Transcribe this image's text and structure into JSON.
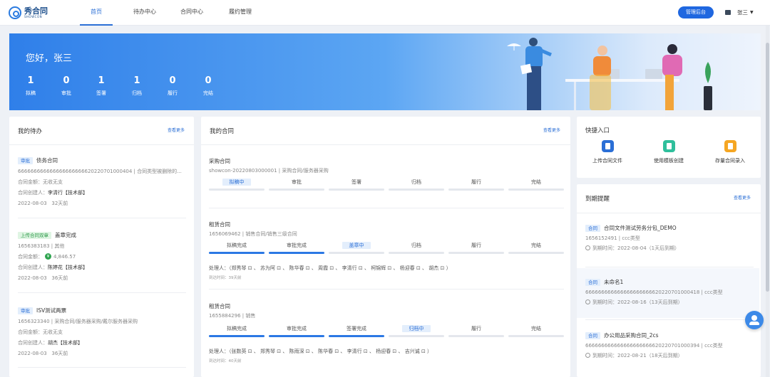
{
  "brand": {
    "name": "秀合同",
    "sub": "SHOWCON"
  },
  "nav": {
    "tabs": [
      {
        "label": "首页",
        "active": true
      },
      {
        "label": "待办中心"
      },
      {
        "label": "合同中心"
      },
      {
        "label": "履约管理"
      }
    ],
    "admin_label": "管理后台",
    "user_name": "张三"
  },
  "banner": {
    "greeting": "您好，张三",
    "stats": [
      {
        "num": "1",
        "label": "拟稿"
      },
      {
        "num": "0",
        "label": "审批"
      },
      {
        "num": "1",
        "label": "签署"
      },
      {
        "num": "1",
        "label": "归档"
      },
      {
        "num": "0",
        "label": "履行"
      },
      {
        "num": "0",
        "label": "完结"
      }
    ]
  },
  "todo": {
    "title": "我的待办",
    "more": "查看更多",
    "items": [
      {
        "tag": "审批",
        "tag_color": "blue",
        "title": "债务合同",
        "line1": "666666666666666666666620220701000404 | 合同类型被删除的...",
        "amount_label": "合同金额：",
        "amount": "无收无支",
        "creator_label": "合同创建人：",
        "creator": "李清行【技术部】",
        "date": "2022-08-03",
        "ago": "32天前"
      },
      {
        "tag": "上传合同双章",
        "tag_color": "green",
        "title": "盖章完成",
        "line1": "1656383183 | 其他",
        "amount_label": "合同金额：",
        "amount": "4,846.57",
        "creator_label": "合同创建人：",
        "creator": "陈婷花【技术部】",
        "date": "2022-08-03",
        "ago": "36天前"
      },
      {
        "tag": "审批",
        "tag_color": "blue",
        "title": "ISV测试两票",
        "line1": "1656323340 | 采购合同/服务器采购/戴尔服务器采购",
        "amount_label": "合同金额：",
        "amount": "无收无支",
        "creator_label": "合同创建人：",
        "creator": "胡杰【技术部】",
        "date": "2022-08-03",
        "ago": "36天前"
      }
    ]
  },
  "contracts": {
    "title": "我的合同",
    "more": "查看更多",
    "items": [
      {
        "title": "采购合同",
        "sub": "showcon-20220803000001 | 采购合同/服务器采购",
        "steps": [
          "拟稿中",
          "审批",
          "签署",
          "归档",
          "履行",
          "完结"
        ]
      },
      {
        "title": "租赁合同",
        "sub": "1656069462 | 销售合同/销售三级合同",
        "steps": [
          "拟稿完成",
          "审批完成",
          "盖章中",
          "归档",
          "履行",
          "完结"
        ],
        "handlers": "处理人：（郑秀琴 ⊡ 、 苏为阿 ⊡ 、 陈华春 ⊡ 、 周霞 ⊡ 、 李清行 ⊡ 、 柯锦辉 ⊡ 、 杨迎春 ⊡ 、 胡杰 ⊡ ）",
        "arrive": "到达时间：39天前"
      },
      {
        "title": "租赁合同",
        "sub": "1655884296 | 销售",
        "steps": [
          "拟稿完成",
          "审批完成",
          "签署完成",
          "归档中",
          "履行",
          "完结"
        ],
        "handlers": "处理人：（张数英 ⊡ 、 郑秀琴 ⊡ 、 陈雨深 ⊡ 、 陈华春 ⊡ 、 李清行 ⊡ 、 杨迎春 ⊡ 、 吉兴诚 ⊡ ）",
        "arrive": "到达时间：40天前"
      }
    ]
  },
  "quick": {
    "title": "快捷入口",
    "items": [
      {
        "label": "上传合同文件",
        "icon": "upload-file-icon",
        "color": "#2b6fd6"
      },
      {
        "label": "使用模板创建",
        "icon": "template-icon",
        "color": "#2fbf9c"
      },
      {
        "label": "存量合同录入",
        "icon": "archive-icon",
        "color": "#f5a623"
      }
    ]
  },
  "remind": {
    "title": "到期提醒",
    "more": "查看更多",
    "items": [
      {
        "tag": "合同",
        "title": "合同文件测试劳务分包_DEMO",
        "line1": "1656152491 | ccc类型",
        "due_label": "到期时间：",
        "due": "2022-08-04（1天后到期）"
      },
      {
        "tag": "合同",
        "title": "未命名1",
        "line1": "666666666666666666666620220701000418 | ccc类型",
        "due_label": "到期时间：",
        "due": "2022-08-16（13天后到期）"
      },
      {
        "tag": "合同",
        "title": "办公用品采购合同_2cs",
        "line1": "666666666666666666666620220701000394 | ccc类型",
        "due_label": "到期时间：",
        "due": "2022-08-21（18天后到期）"
      }
    ]
  },
  "colors": {
    "primary": "#1f67e0",
    "banner_start": "#2f7fe9",
    "done_bar": "#2b78e4"
  }
}
